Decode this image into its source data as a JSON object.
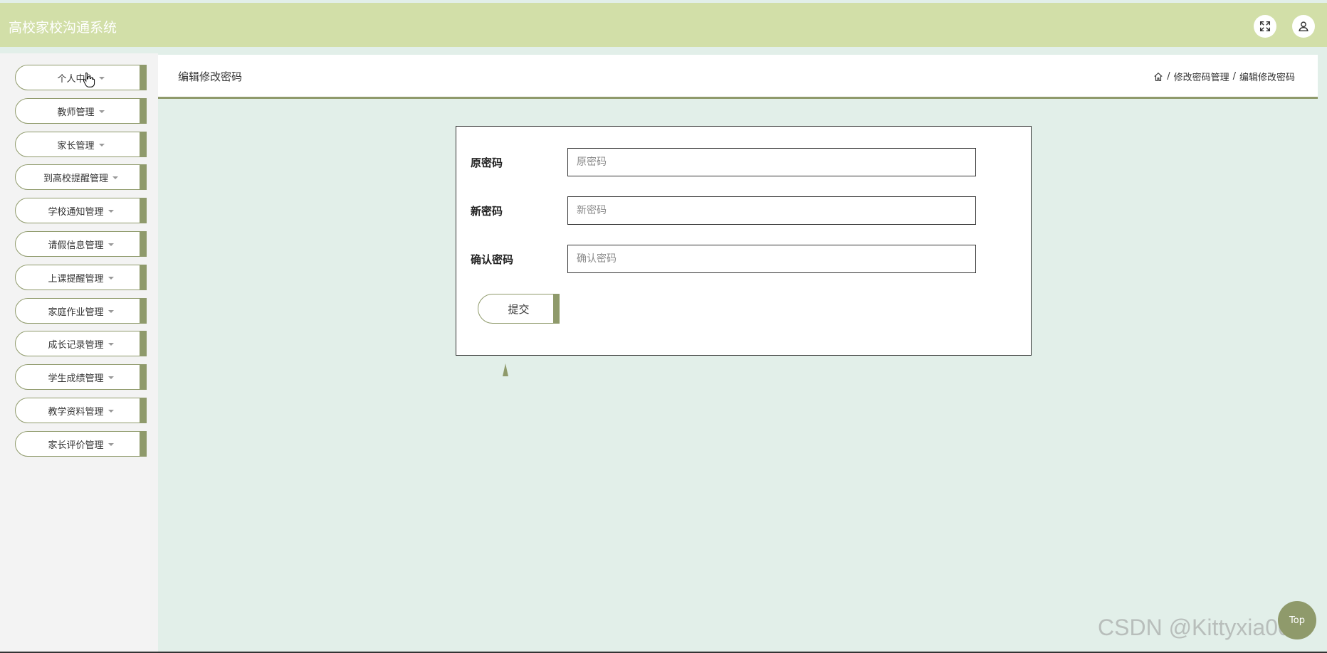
{
  "app": {
    "title": "高校家校沟通系统"
  },
  "header_icons": [
    {
      "name": "fullscreen-icon"
    },
    {
      "name": "user-icon"
    }
  ],
  "sidebar": {
    "items": [
      {
        "label": "个人中心"
      },
      {
        "label": "教师管理"
      },
      {
        "label": "家长管理"
      },
      {
        "label": "到高校提醒管理"
      },
      {
        "label": "学校通知管理"
      },
      {
        "label": "请假信息管理"
      },
      {
        "label": "上课提醒管理"
      },
      {
        "label": "家庭作业管理"
      },
      {
        "label": "成长记录管理"
      },
      {
        "label": "学生成绩管理"
      },
      {
        "label": "教学资料管理"
      },
      {
        "label": "家长评价管理"
      }
    ]
  },
  "page": {
    "title": "编辑修改密码",
    "breadcrumb": {
      "home_icon": "home-icon",
      "sep1": "/",
      "level1": "修改密码管理",
      "sep2": "/",
      "level2": "编辑修改密码"
    }
  },
  "form": {
    "old_password": {
      "label": "原密码",
      "placeholder": "原密码",
      "value": ""
    },
    "new_password": {
      "label": "新密码",
      "placeholder": "新密码",
      "value": ""
    },
    "confirm_password": {
      "label": "确认密码",
      "placeholder": "确认密码",
      "value": ""
    },
    "submit_label": "提交"
  },
  "back_to_top": {
    "label": "Top"
  },
  "watermark": "CSDN @Kittyxia001",
  "colors": {
    "topbar": "#d2dfa8",
    "accent": "#8f9a6b",
    "background": "#e2efe9",
    "sidebar": "#f3f3f3"
  }
}
